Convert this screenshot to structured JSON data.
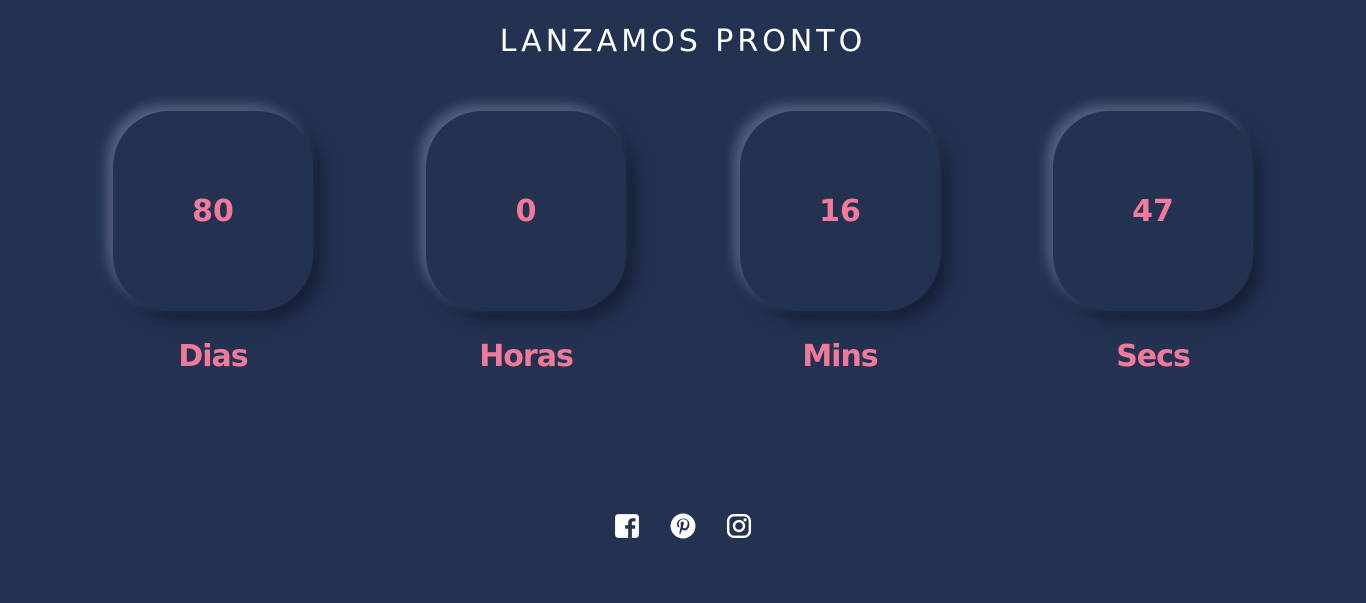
{
  "title": "LANZAMOS PRONTO",
  "countdown": [
    {
      "value": "80",
      "label": "Dias"
    },
    {
      "value": "0",
      "label": "Horas"
    },
    {
      "value": "16",
      "label": "Mins"
    },
    {
      "value": "47",
      "label": "Secs"
    }
  ],
  "social": [
    {
      "icon": "facebook-icon"
    },
    {
      "icon": "pinterest-icon"
    },
    {
      "icon": "instagram-icon"
    }
  ],
  "colors": {
    "background": "#243252",
    "accent": "#f07a9a",
    "title": "#ffffff"
  }
}
